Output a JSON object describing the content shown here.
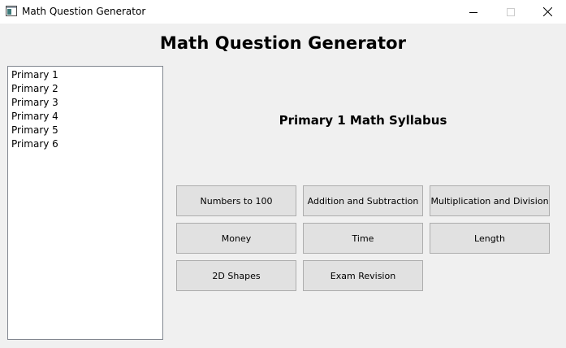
{
  "window": {
    "title": "Math Question Generator",
    "icon": "app-window-icon",
    "controls": [
      "minimize-icon",
      "maximize-icon",
      "close-icon"
    ]
  },
  "header": {
    "title": "Math Question Generator"
  },
  "levels": {
    "items": [
      {
        "label": "Primary 1"
      },
      {
        "label": "Primary 2"
      },
      {
        "label": "Primary 3"
      },
      {
        "label": "Primary 4"
      },
      {
        "label": "Primary 5"
      },
      {
        "label": "Primary 6"
      }
    ]
  },
  "syllabus": {
    "title": "Primary 1 Math Syllabus",
    "topics": [
      {
        "label": "Numbers to 100"
      },
      {
        "label": "Addition and Subtraction"
      },
      {
        "label": "Multiplication and Division"
      },
      {
        "label": "Money"
      },
      {
        "label": "Time"
      },
      {
        "label": "Length"
      },
      {
        "label": "2D Shapes"
      },
      {
        "label": "Exam Revision"
      }
    ]
  },
  "colors": {
    "window_bg": "#f0f0f0",
    "titlebar_bg": "#ffffff",
    "button_bg": "#e1e1e1",
    "button_border": "#adadad",
    "list_border": "#828790"
  }
}
